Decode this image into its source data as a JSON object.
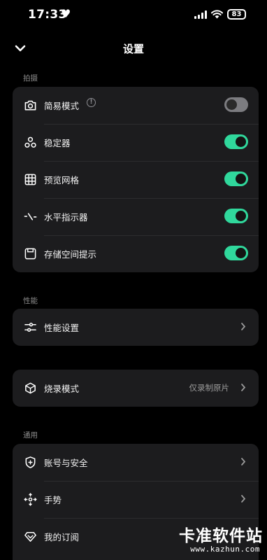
{
  "status": {
    "time": "17:33",
    "battery": "83"
  },
  "header": {
    "title": "设置"
  },
  "sections": {
    "capture": "拍摄",
    "performance": "性能",
    "general": "通用"
  },
  "capture_items": [
    {
      "label": "简易模式",
      "toggle": "off"
    },
    {
      "label": "稳定器",
      "toggle": "on"
    },
    {
      "label": "预览网格",
      "toggle": "on"
    },
    {
      "label": "水平指示器",
      "toggle": "on"
    },
    {
      "label": "存储空间提示",
      "toggle": "on"
    }
  ],
  "performance_items": [
    {
      "label": "性能设置"
    }
  ],
  "burn_items": [
    {
      "label": "烧录模式",
      "value": "仅录制原片"
    }
  ],
  "general_items": [
    {
      "label": "账号与安全"
    },
    {
      "label": "手势"
    },
    {
      "label": "我的订阅"
    }
  ],
  "colors": {
    "accent": "#30d89c",
    "card": "#1c1c1e",
    "background": "#000000"
  },
  "watermark": {
    "main": "卡准软件站",
    "url": "www.kazhun.com"
  }
}
